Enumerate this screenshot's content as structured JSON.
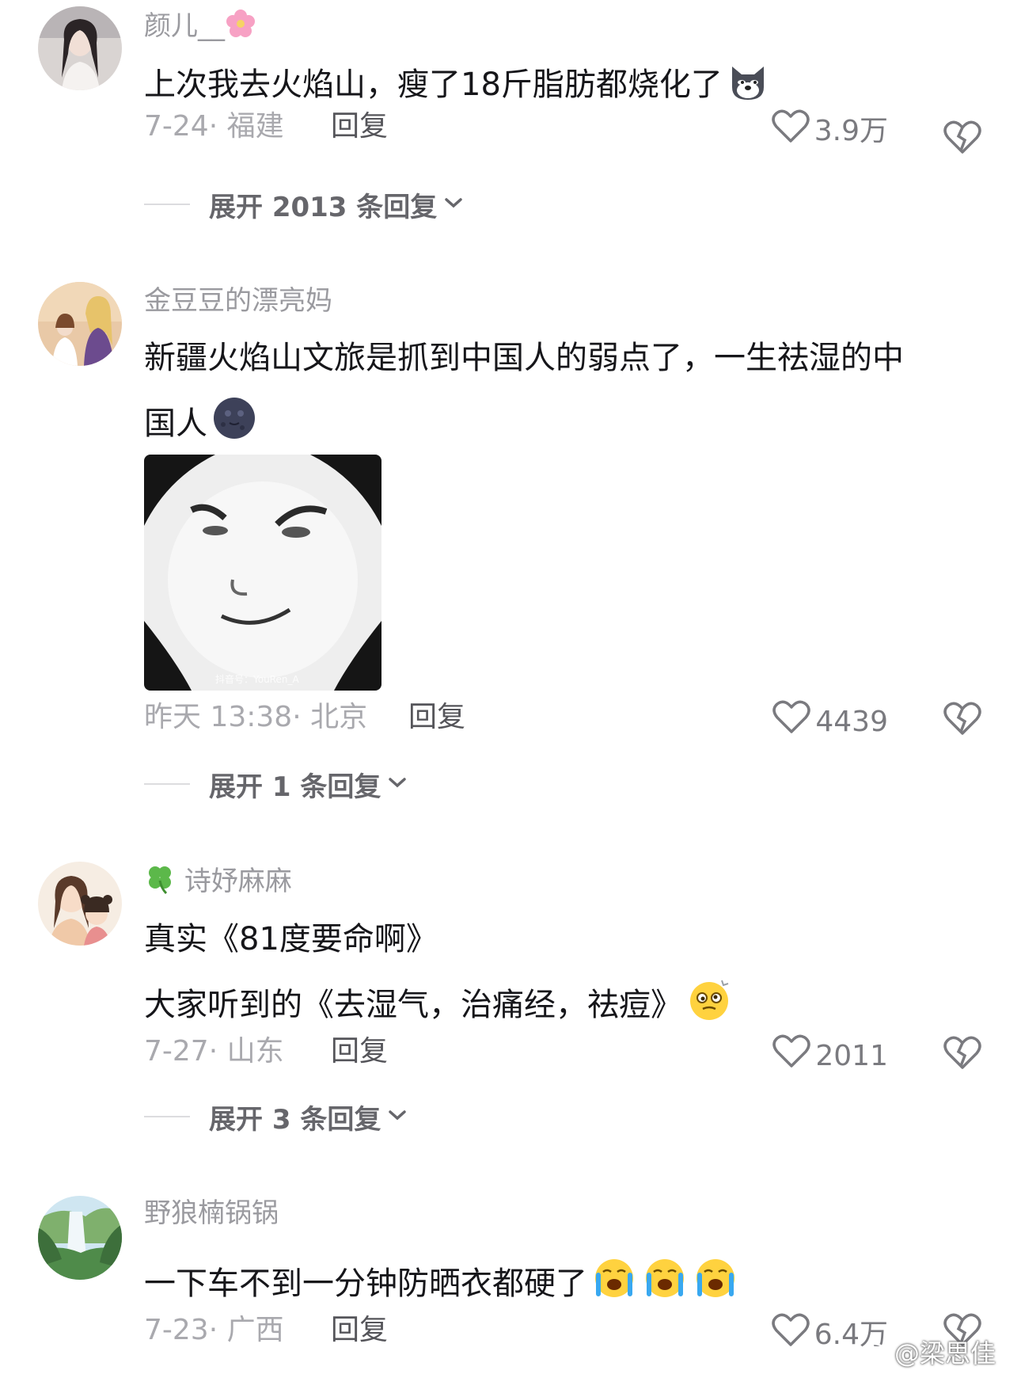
{
  "comments": [
    {
      "username": "颜儿__",
      "username_emoji": "cherry-blossom-icon",
      "text": "上次我去火焰山，瘦了18斤脂肪都烧化了",
      "text_emoji": "dog-face-icon",
      "date_location": "7-24· 福建",
      "reply_label": "回复",
      "likes": "3.9万",
      "expand_label": "展开 2013 条回复"
    },
    {
      "username": "金豆豆的漂亮妈",
      "text_line1": "新疆火焰山文旅是抓到中国人的弱点了，一生祛湿的中",
      "text_line2": "国人",
      "text_emoji": "dark-moon-face-icon",
      "sticker_watermark": "抖音号：YouRen_A",
      "date_location": "昨天 13:38· 北京",
      "reply_label": "回复",
      "likes": "4439",
      "expand_label": "展开 1 条回复"
    },
    {
      "username": "诗妤麻麻",
      "username_emoji": "four-leaf-clover-icon",
      "text_line1": "真实《81度要命啊》",
      "text_line2": "大家听到的《去湿气，治痛经，祛痘》",
      "text_emoji": "dizzy-face-icon",
      "date_location": "7-27· 山东",
      "reply_label": "回复",
      "likes": "2011",
      "expand_label": "展开 3 条回复"
    },
    {
      "username": "野狼楠锅锅",
      "text": "一下车不到一分钟防晒衣都硬了",
      "text_emoji": "crying-face-icon",
      "date_location": "7-23· 广西",
      "reply_label": "回复",
      "likes": "6.4万"
    }
  ],
  "watermark": "@梁思佳",
  "colors": {
    "text": "#16161a",
    "secondary": "#9a9a9f",
    "meta": "#a9a9ae",
    "icon": "#7a7a7f"
  }
}
